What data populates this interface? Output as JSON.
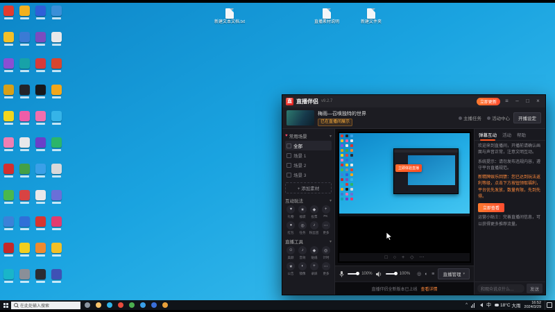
{
  "desktop": {
    "icon_colors": [
      "#e23b2e",
      "#f2c027",
      "#8a4fd3",
      "#d8a017",
      "#f2d51e",
      "#ef7fb3",
      "#d32f2f",
      "#49b84e",
      "#3b82d8",
      "#c62828",
      "#19b5c9",
      "#f2b01e",
      "#3a7bd5",
      "#17a2a8",
      "#23242a",
      "#ef5da8",
      "#e8e8ea",
      "#43a047",
      "#d84343",
      "#2f6fd8",
      "#f2cf1e",
      "#8a8f98",
      "#2f5fd8",
      "#7a4dbf",
      "#d83a3a",
      "#17181c",
      "#ef6fae",
      "#6a3fc9",
      "#3aa0e8",
      "#e8e8ea",
      "#d8352f",
      "#ef8a2f",
      "#2b2d33",
      "#3a8fd8",
      "#e8e8ea",
      "#d8452f",
      "#f2a71b",
      "#35b4e8",
      "#2bb56a",
      "#d8d8da",
      "#6a6fd8",
      "#e23b6e",
      "#f2c027",
      "#3f51b5"
    ],
    "files": [
      {
        "label": "新建文本文档.txt"
      },
      {
        "label": "直播素材说明"
      },
      {
        "label": "新建文件夹"
      }
    ]
  },
  "window": {
    "titlebar": {
      "app_name": "直播伴侣",
      "version": "v9.2.7",
      "update_label": "立即更新"
    },
    "header": {
      "game_title": "梅雨—召唤独特的世界",
      "game_tag": "已在直播间展示",
      "stats": [
        {
          "label": "主播任务"
        },
        {
          "label": "活动中心"
        }
      ],
      "settings_label": "开播设定"
    },
    "sidebar": {
      "scenes_header": "常用场景",
      "scenes": [
        {
          "label": "全部"
        },
        {
          "label": "场景 1"
        },
        {
          "label": "场景 2"
        },
        {
          "label": "场景 3"
        }
      ],
      "add_source_label": "+ 添加素材",
      "interact_header": "互动玩法",
      "interact_tools": [
        {
          "glyph": "♥",
          "label": "礼物"
        },
        {
          "glyph": "★",
          "label": "福袋"
        },
        {
          "glyph": "◆",
          "label": "投票"
        },
        {
          "glyph": "+",
          "label": "PK"
        },
        {
          "glyph": "●",
          "label": "红包"
        },
        {
          "glyph": "◎",
          "label": "任务"
        },
        {
          "glyph": "♪",
          "label": "粉丝团"
        },
        {
          "glyph": "⋯",
          "label": "更多"
        }
      ],
      "tools_header": "直播工具",
      "live_tools": [
        {
          "glyph": "☺",
          "label": "美颜"
        },
        {
          "glyph": "♪",
          "label": "音效"
        },
        {
          "glyph": "◆",
          "label": "贴纸"
        },
        {
          "glyph": "◎",
          "label": "计时"
        },
        {
          "glyph": "★",
          "label": "公告"
        },
        {
          "glyph": "◐",
          "label": "镜像"
        },
        {
          "glyph": "+",
          "label": "录屏"
        },
        {
          "glyph": "⋯",
          "label": "更多"
        }
      ]
    },
    "preview": {
      "cta_label": "立即体验直播",
      "toolbar_glyphs": [
        "□",
        "○",
        "+",
        "◇",
        "⋯"
      ]
    },
    "controls": {
      "mic_pct": "100%",
      "speaker_pct": "100%",
      "manage_label": "直播管理",
      "footer_note": "直播伴侣全新版本已上线",
      "footer_link": "查看详情"
    },
    "right_panel": {
      "tabs": [
        {
          "label": "弹幕互动",
          "active": true
        },
        {
          "label": "活动"
        },
        {
          "label": "帮助"
        }
      ],
      "messages": [
        {
          "text": "欢迎来到直播间，开播前请确认画面与声音正常，注意文明互动。"
        },
        {
          "text": "系统提示：请勿发布违规内容，遵守平台直播规范。"
        },
        {
          "text": "新精牌娱乐回馈：您已达到玩法返利等级，点击下方按钮领取福利，平台优先发放，数量有限，先到先得。",
          "highlight": true,
          "cta": "立即查看"
        },
        {
          "text": "运营小贴士：完善直播间信息，可以获得更多推荐流量。"
        }
      ],
      "input_placeholder": "和观众说点什么…",
      "send_label": "发送"
    }
  },
  "taskbar": {
    "search_placeholder": "在此处输入搜索",
    "icons": [
      {
        "name": "task-view-icon",
        "color": "#8b95a1"
      },
      {
        "name": "explorer-icon",
        "color": "#f7c36b"
      },
      {
        "name": "edge-icon",
        "color": "#2fb3e8"
      },
      {
        "name": "chrome-icon",
        "color": "#e84b3c"
      },
      {
        "name": "wechat-icon",
        "color": "#4caf50"
      },
      {
        "name": "qq-icon",
        "color": "#3aa0e8"
      },
      {
        "name": "store-icon",
        "color": "#3a6fd8"
      },
      {
        "name": "game-icon",
        "color": "#e8a03a"
      }
    ],
    "tray": {
      "ime": "中",
      "weather_temp": "18°C",
      "weather_desc": "大雨",
      "time": "16:52",
      "date": "2024/3/29"
    }
  }
}
